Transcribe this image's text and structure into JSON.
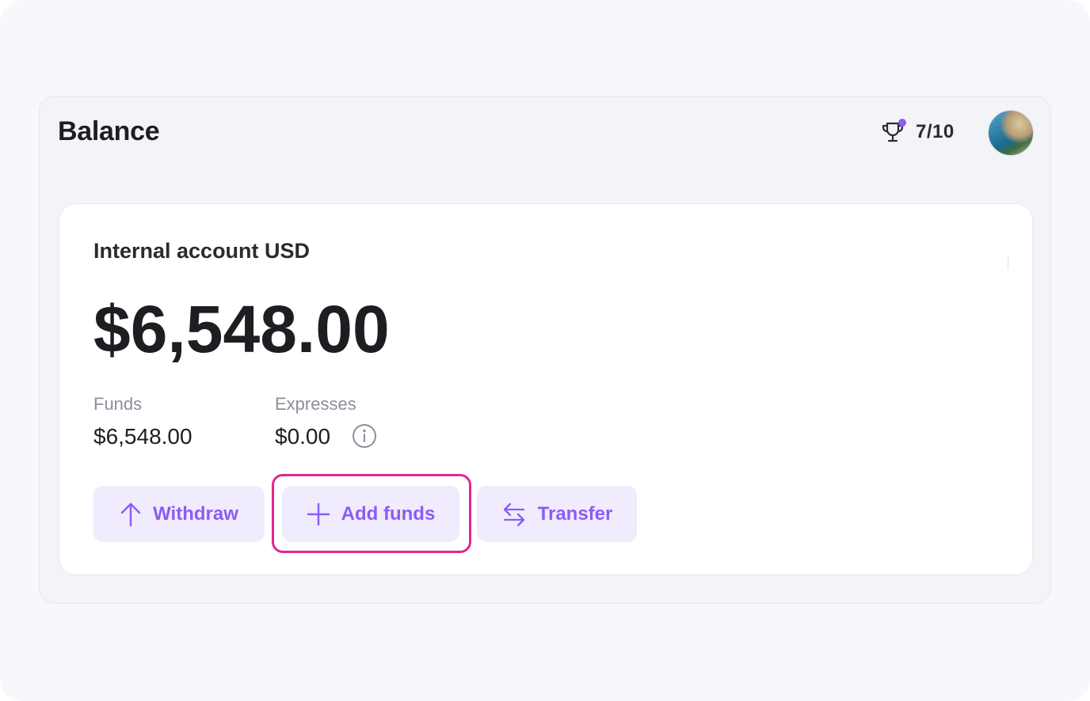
{
  "header": {
    "title": "Balance",
    "progress": "7/10",
    "trophy_icon": "trophy-icon",
    "notification_color": "#8b5cf6"
  },
  "account": {
    "name": "Internal account USD",
    "balance": "$6,548.00",
    "funds_label": "Funds",
    "funds_value": "$6,548.00",
    "expenses_label": "Expresses",
    "expenses_value": "$0.00",
    "info_icon": "info-icon"
  },
  "actions": {
    "withdraw_label": "Withdraw",
    "add_funds_label": "Add funds",
    "transfer_label": "Transfer"
  },
  "colors": {
    "accent": "#8b5cf6",
    "button_bg": "#f1ebfe",
    "highlight": "#e0288f"
  }
}
